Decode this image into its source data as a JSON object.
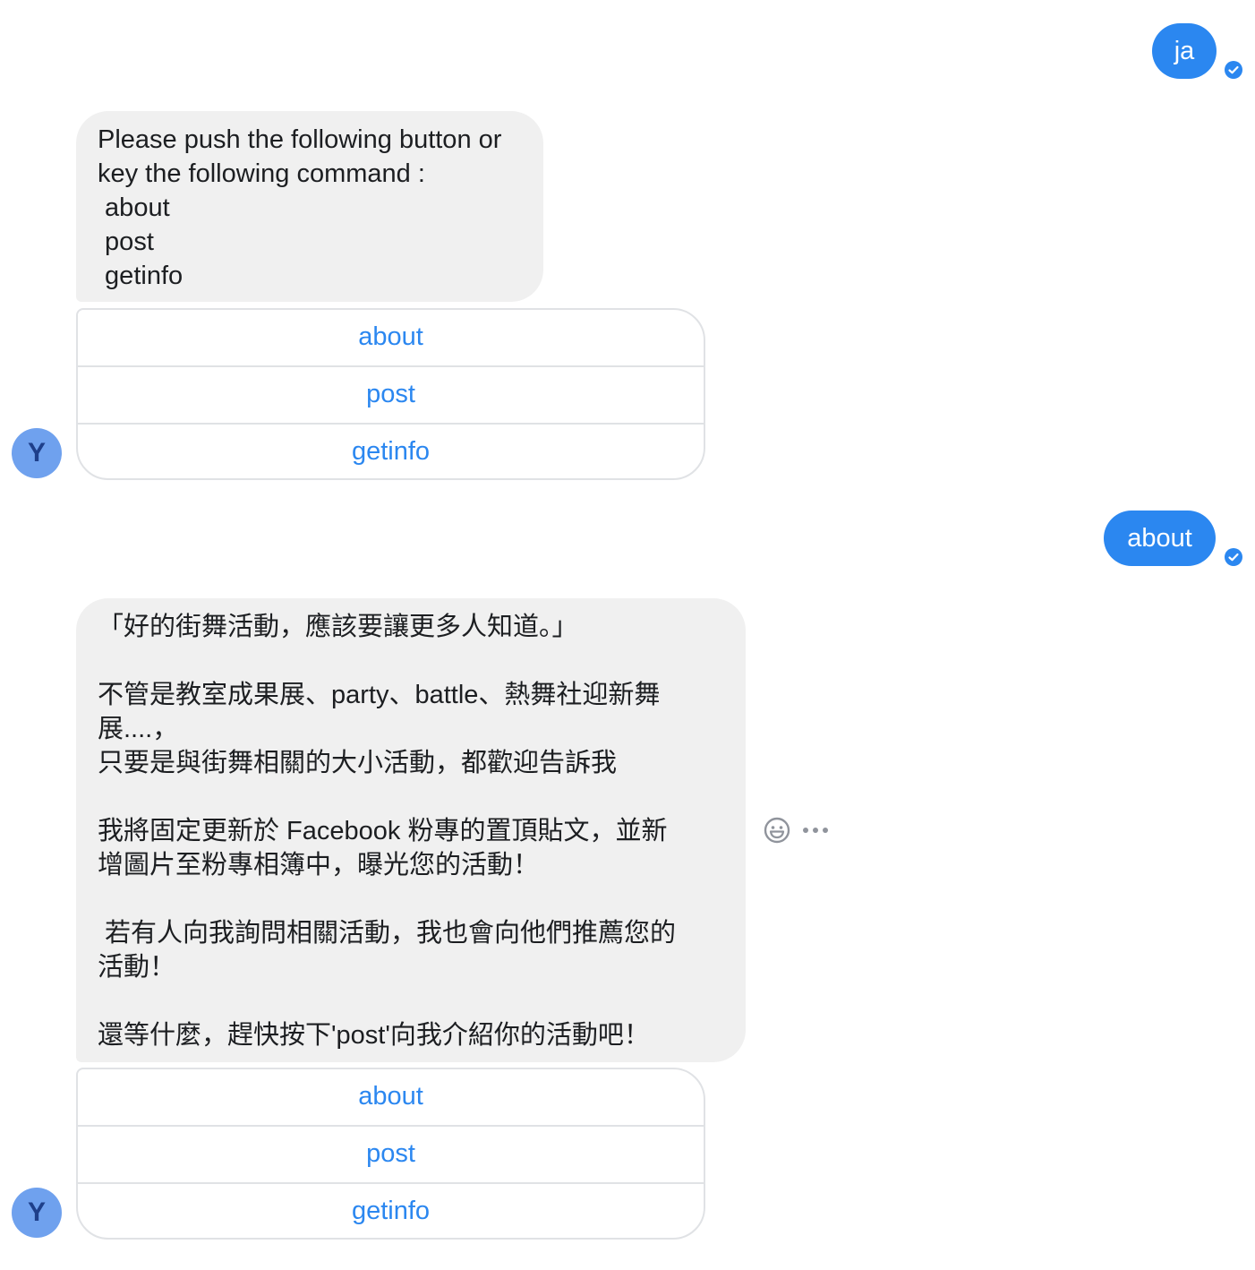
{
  "messages": {
    "user_1": {
      "text": "ja"
    },
    "bot_1": {
      "lines": [
        "Please push the following button or",
        "key the following command :",
        " about",
        " post",
        " getinfo"
      ],
      "buttons": [
        "about",
        "post",
        "getinfo"
      ],
      "avatar_letter": "Y"
    },
    "user_2": {
      "text": "about"
    },
    "bot_2": {
      "lines": [
        "「好的街舞活動，應該要讓更多人知道。」",
        "",
        "不管是教室成果展、party、battle、熱舞社迎新舞",
        "展....，",
        "只要是與街舞相關的大小活動，都歡迎告訴我",
        "",
        "我將固定更新於 Facebook 粉專的置頂貼文，並新",
        "增圖片至粉專相簿中，曝光您的活動！",
        "",
        " 若有人向我詢問相關活動，我也會向他們推薦您的",
        "活動！",
        "",
        "還等什麼，趕快按下'post'向我介紹你的活動吧！"
      ],
      "buttons": [
        "about",
        "post",
        "getinfo"
      ],
      "avatar_letter": "Y"
    }
  },
  "icons": {
    "seen": "check-circle-icon",
    "react": "emoji-smile-icon",
    "more": "more-dots-icon"
  },
  "colors": {
    "accent": "#2b87f0",
    "bubble_gray": "#f0f0f0",
    "avatar": "#6fa1ee"
  }
}
